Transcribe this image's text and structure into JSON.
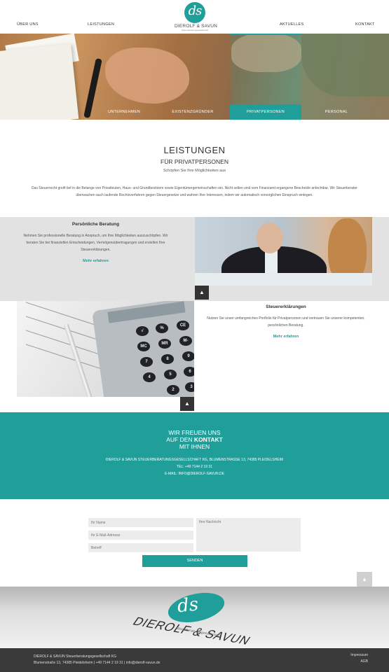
{
  "nav": {
    "left": [
      "ÜBER UNS",
      "LEISTUNGEN"
    ],
    "right": [
      "AKTUELLES",
      "KONTAKT"
    ]
  },
  "logo": {
    "monogram": "ds",
    "name": "DIEROLF & SAVUN",
    "sub": "Steuerberatungsgesellschaft"
  },
  "hero": {
    "tabs": [
      "UNTERNEHMEN",
      "EXISTENZGRÜNDER",
      "PRIVATPERSONEN",
      "PERSONAL"
    ],
    "active_tab": "PRIVATPERSONEN"
  },
  "intro": {
    "title": "LEISTUNGEN",
    "subtitle": "FÜR PRIVATPERSONEN",
    "lead": "Schöpfen Sie Ihre Möglichkeiten aus",
    "body": "Das Steuerrecht greift tief in die Belange von Privatleuten, Haus- und Grundbesitzern sowie Eigentümergemeinschaften ein. Nicht selten sind vom Finanzamt ergangene Bescheide anfechtbar. Wir Steuerberater überwachen auch laufende Rechtsverfahren gegen Steuergesetze und wahren Ihre Interessen, indem wir automatisch vorsorglichen Einspruch einlegen."
  },
  "services": [
    {
      "title": "Persönliche Beratung",
      "desc": "Nehmen Sie professionelle Beratung in Anspruch, um Ihre Möglichkeiten auszuschöpfen. Wir beraten Sie bei finanziellen Entscheidungen, Vermögensübertragungen und erstellen Ihre Steuererklärungen.",
      "link": "Mehr erfahren"
    },
    {
      "title": "Steuererklärungen",
      "desc": "Nutzen Sie unser umfangreiches Portfolio für Privatpersonen und vertrauen Sie unserer kompetenten, persönlichen Beratung.",
      "link": "Mehr erfahren"
    }
  ],
  "calculator_keys": [
    "CE",
    "%",
    "√",
    "MC",
    "MR",
    "M-",
    "7",
    "8",
    "9",
    "4",
    "5",
    "6",
    "2",
    "3"
  ],
  "contact": {
    "line1": "WIR FREUEN UNS",
    "line2_pre": "AUF DEN ",
    "line2_bold": "KONTAKT",
    "line3": "MIT IHNEN",
    "address": "DIEROLF & SAVUN STEUERBERATUNGSGESELLSCHAFT KG, BLUMENSTRASSE 13, 74385 PLEIDELSHEIM",
    "phone": "TEL: +49 7144 2 19 31",
    "email": "E-MAIL: INFO@DIEROLF-SAVUN.DE"
  },
  "form": {
    "name_placeholder": "Ihr Name",
    "email_placeholder": "Ihr E-Mail-Adresse",
    "subject_placeholder": "Betreff",
    "message_placeholder": "Ihre Nachricht",
    "submit_label": "SENDEN"
  },
  "banner": {
    "monogram": "ds",
    "name": "DIEROLF & SAVUN",
    "sub": "Steuerberatungsgesellschaft"
  },
  "footer": {
    "company": "DIEROLF & SAVUN Steuerberatungsgesellschaft KG",
    "address": "Blumenstraße 13, 74385 Pleidelsheim | +49 7144 2 19 31 | info@dierolf-savun.de",
    "links": [
      "Impressum",
      "AGB"
    ]
  },
  "colors": {
    "accent": "#1f9e9a",
    "dark": "#333333",
    "light_gray": "#e2e2e2",
    "footer": "#3a3a3a"
  },
  "icons": {
    "scroll_up": "chevron-up-icon"
  }
}
